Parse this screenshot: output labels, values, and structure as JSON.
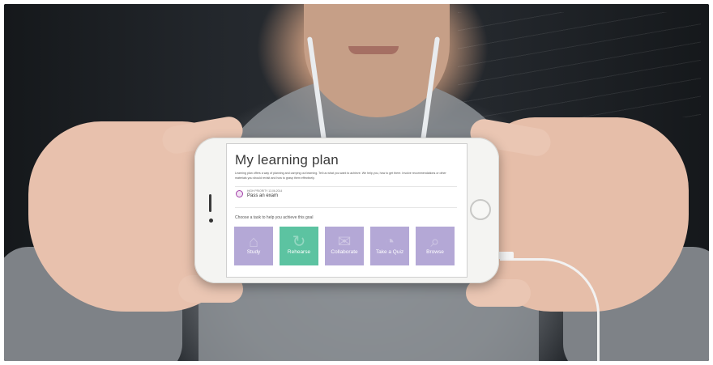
{
  "app": {
    "title": "My learning plan",
    "intro": "Learning plan offers a way of planning and carrying out learning. Tell us what you want to achieve. We help you, how to get there. Involve recommendations or other materials you should revisit and how to grasp them effectively.",
    "goal": {
      "priority_label": "HIGH PRIORITY   13.06.2014",
      "title": "Pass an exam",
      "icon": "star-badge-icon"
    },
    "task_prompt": "Choose a task to help you achieve this goal",
    "tasks": [
      {
        "label": "Study",
        "icon": "book-icon",
        "active": false
      },
      {
        "label": "Rehearse",
        "icon": "refresh-icon",
        "active": true
      },
      {
        "label": "Collaborate",
        "icon": "chat-icon",
        "active": false
      },
      {
        "label": "Take a Quiz",
        "icon": "stopwatch-icon",
        "active": false
      },
      {
        "label": "Browse",
        "icon": "magnifier-icon",
        "active": false
      }
    ]
  },
  "colors": {
    "tile_default": "#b4a8d6",
    "tile_active": "#5cc3a1",
    "badge": "#a23ea8"
  }
}
